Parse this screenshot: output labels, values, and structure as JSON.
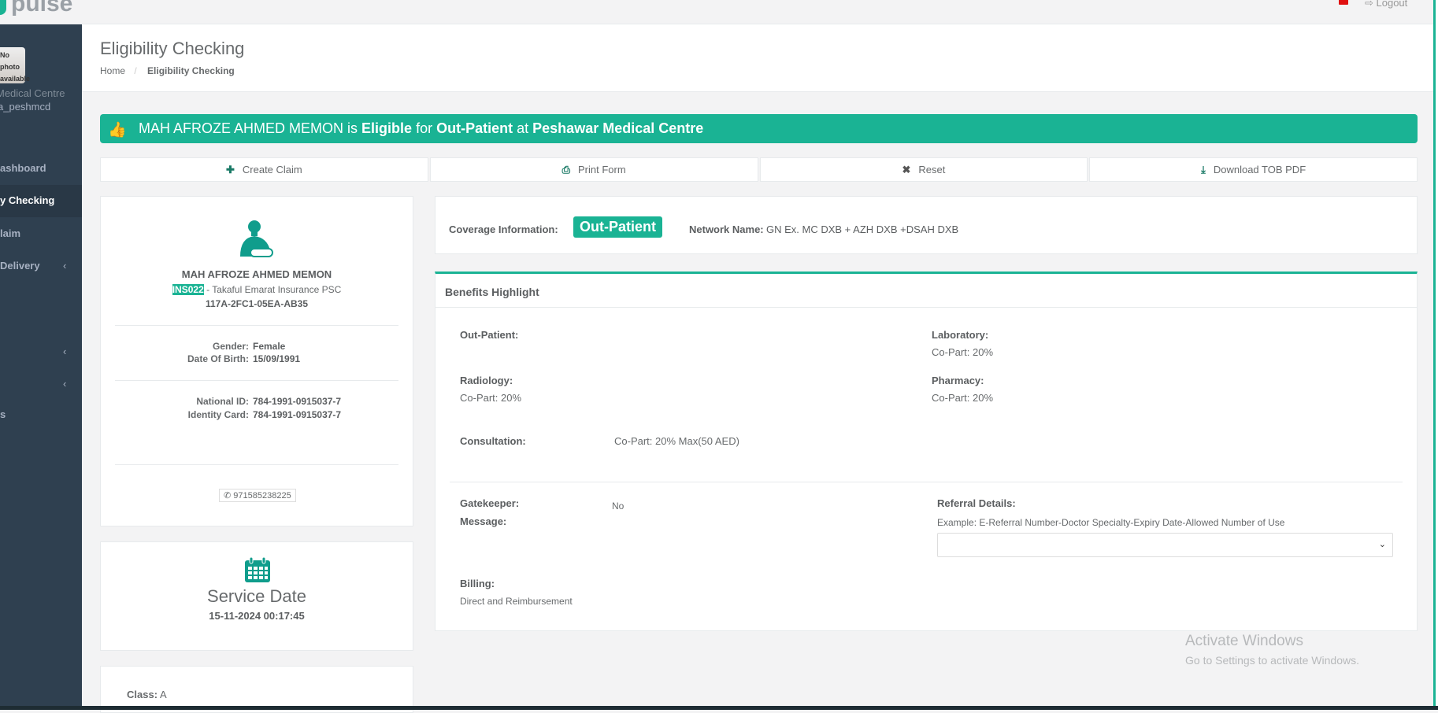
{
  "topbar": {
    "logo": "pulse",
    "logout": "Logout"
  },
  "sidebar": {
    "photo_text": "No photo available",
    "org": "Medical Centre",
    "user": "a_peshmcd",
    "items": [
      {
        "label": "ashboard"
      },
      {
        "label": "y Checking"
      },
      {
        "label": "laim"
      },
      {
        "label": "Delivery"
      },
      {
        "label": "s"
      }
    ]
  },
  "header": {
    "title": "Eligibility Checking",
    "breadcrumb": [
      "Home",
      "Eligibility Checking"
    ]
  },
  "banner": {
    "name": "MAH AFROZE AHMED MEMON",
    "is": "is",
    "status": "Eligible",
    "for": "for",
    "type": "Out-Patient",
    "at": "at",
    "facility": "Peshawar Medical Centre"
  },
  "actions": {
    "create": "Create Claim",
    "print": "Print Form",
    "reset": "Reset",
    "download": "Download TOB PDF"
  },
  "patient": {
    "name": "MAH AFROZE AHMED MEMON",
    "ins_code": "INS022",
    "insurer": "- Takaful Emarat Insurance PSC",
    "card_no": "117A-2FC1-05EA-AB35",
    "gender_label": "Gender:",
    "gender": "Female",
    "dob_label": "Date Of Birth:",
    "dob": "15/09/1991",
    "nid_label": "National ID:",
    "nid": "784-1991-0915037-7",
    "idc_label": "Identity Card:",
    "idc": "784-1991-0915037-7",
    "phone": "971585238225"
  },
  "service": {
    "title": "Service Date",
    "value": "15-11-2024 00:17:45"
  },
  "class": {
    "label": "Class:",
    "value": "A"
  },
  "coverage": {
    "label": "Coverage Information:",
    "badge": "Out-Patient",
    "network_label": "Network Name:",
    "network": "GN Ex. MC DXB + AZH DXB +DSAH DXB"
  },
  "benefits": {
    "title": "Benefits Highlight",
    "outpatient": "Out-Patient:",
    "laboratory": "Laboratory:",
    "laboratory_val": "Co-Part: 20%",
    "radiology": "Radiology:",
    "radiology_val": "Co-Part: 20%",
    "pharmacy": "Pharmacy:",
    "pharmacy_val": "Co-Part: 20%",
    "consultation": "Consultation:",
    "consultation_val": "Co-Part: 20% Max(50 AED)",
    "gatekeeper": "Gatekeeper:",
    "gatekeeper_val": "No",
    "message": "Message:",
    "referral": "Referral Details:",
    "referral_example": "Example: E-Referral Number-Doctor Specialty-Expiry Date-Allowed Number of Use",
    "billing": "Billing:",
    "billing_val": "Direct and Reimbursement"
  },
  "watermark": {
    "line1": "Activate Windows",
    "line2": "Go to Settings to activate Windows."
  },
  "colors": {
    "accent": "#1ab394",
    "sidebar": "#2f4050"
  }
}
